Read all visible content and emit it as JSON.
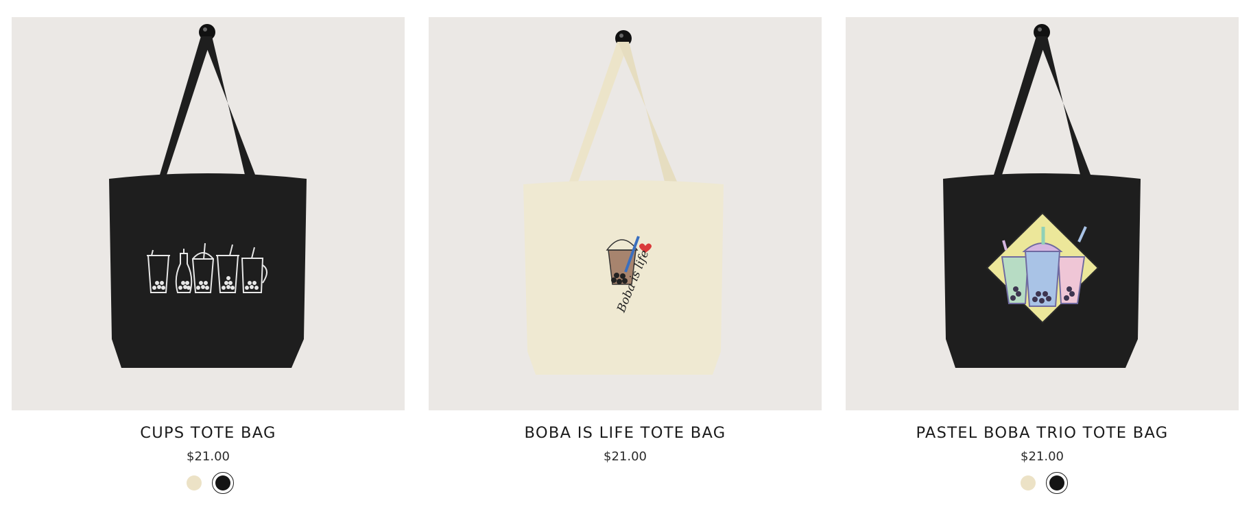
{
  "products": [
    {
      "title": "CUPS TOTE BAG",
      "price": "$21.00",
      "bag_color": "#1e1e1e",
      "swatches": [
        {
          "name": "oyster",
          "color": "#ece2c6",
          "selected": false
        },
        {
          "name": "black",
          "color": "#141414",
          "selected": true
        }
      ]
    },
    {
      "title": "BOBA IS LIFE TOTE BAG",
      "price": "$21.00",
      "bag_color": "#efe9d2",
      "print_text": "Boba is life",
      "swatches": []
    },
    {
      "title": "PASTEL BOBA TRIO TOTE BAG",
      "price": "$21.00",
      "bag_color": "#1e1e1e",
      "swatches": [
        {
          "name": "oyster",
          "color": "#ece2c6",
          "selected": false
        },
        {
          "name": "black",
          "color": "#141414",
          "selected": true
        }
      ]
    }
  ]
}
